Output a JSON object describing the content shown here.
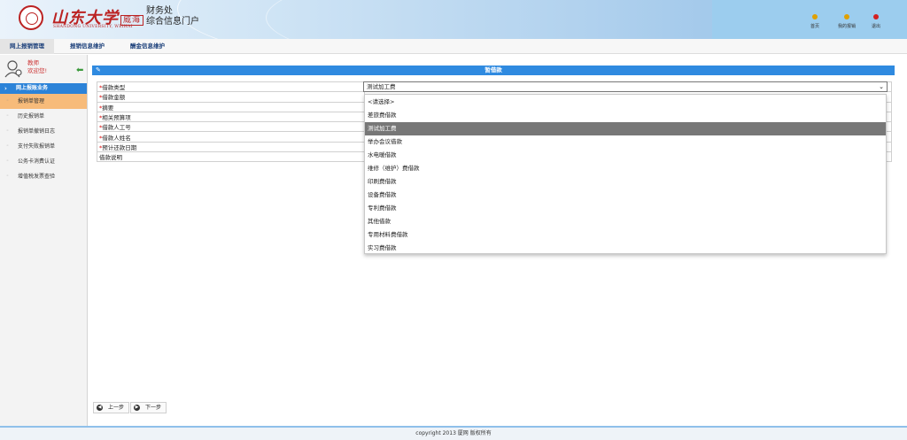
{
  "header": {
    "univ_name": "山东大学",
    "campus": "威海",
    "univ_en": "SHANDONG UNIVERSITY, WEIHAI",
    "dept": "财务处",
    "portal": "综合信息门户",
    "links": [
      {
        "label": "首页",
        "color": "#e0a000"
      },
      {
        "label": "我的报销",
        "color": "#e0a000"
      },
      {
        "label": "退出",
        "color": "#d42020"
      }
    ]
  },
  "tabs": [
    "网上报销管理",
    "报销信息维护",
    "酬金信息维护"
  ],
  "user": {
    "name": "教师",
    "welcome": "欢迎您!"
  },
  "sidebar": {
    "group_label": "网上报账业务",
    "items": [
      "报销单管理",
      "历史报销单",
      "报销单撤销日志",
      "支付失败报销单",
      "公务卡消费认证",
      "增值税发票查验"
    ]
  },
  "panel": {
    "title": "暂借款"
  },
  "form": {
    "rows": [
      {
        "label": "借款类型",
        "required": "*"
      },
      {
        "label": "借款金额",
        "required": "*"
      },
      {
        "label": "摘要",
        "required": "*"
      },
      {
        "label": "相关预算项",
        "required": "*"
      },
      {
        "label": "借款人工号",
        "required": "*"
      },
      {
        "label": "借款人姓名",
        "required": "*"
      },
      {
        "label": "预计还款日期",
        "required": "*"
      },
      {
        "label": "借款说明",
        "required": ""
      }
    ],
    "select_value": "测试加工费",
    "select_caret": "⌄"
  },
  "dropdown": {
    "options": [
      "<请选择>",
      "差旅费借款",
      "测试加工费",
      "举办会议借款",
      "水电暖借款",
      "维修（维护）费借款",
      "印刷费借款",
      "设备费借款",
      "专利费借款",
      "其他借款",
      "专用材料费借款",
      "实习费借款"
    ],
    "selected_index": 2
  },
  "buttons": {
    "prev": "上一步",
    "next": "下一步"
  },
  "footer": {
    "text": "copyright 2013 厦网 版权所有"
  }
}
